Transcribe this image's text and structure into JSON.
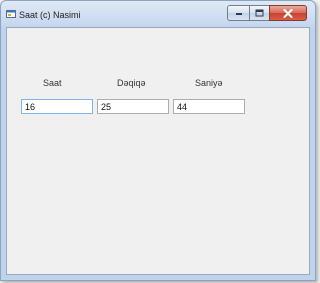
{
  "window": {
    "title": "Saat (c) Nasimi"
  },
  "icons": {
    "app": "app-window-icon",
    "minimize": "minimize-icon",
    "maximize": "maximize-icon",
    "close": "close-icon"
  },
  "fields": {
    "hour": {
      "label": "Saat",
      "value": "16"
    },
    "minute": {
      "label": "Dəqiqə",
      "value": "25"
    },
    "second": {
      "label": "Saniyə",
      "value": "44"
    }
  },
  "colors": {
    "close_button": "#c54230",
    "focused_border": "#7eb4ea"
  }
}
